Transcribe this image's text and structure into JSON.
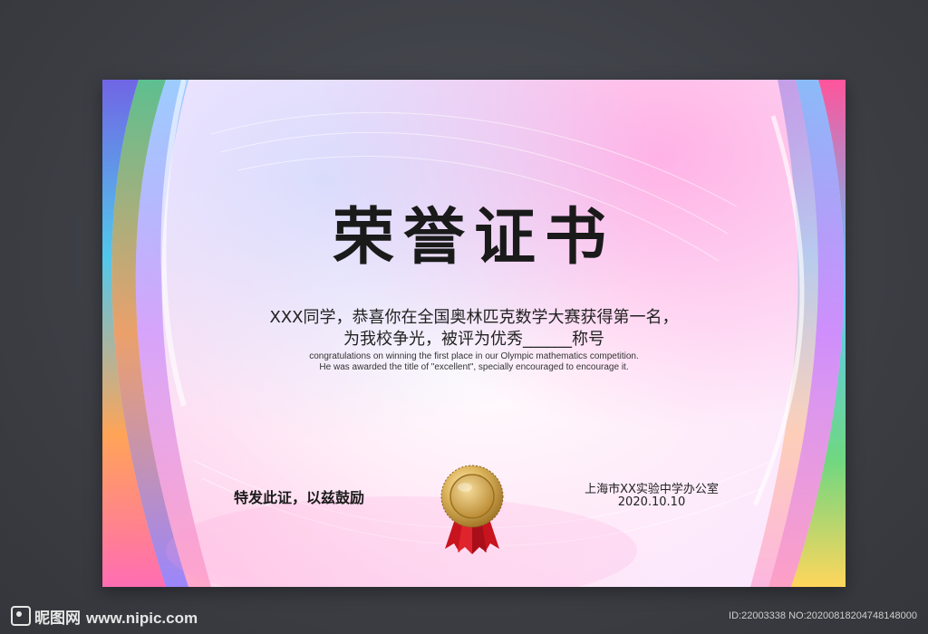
{
  "certificate": {
    "title": "荣誉证书",
    "body_cn_line1": "XXX同学，恭喜你在全国奥林匹克数学大赛获得第一名，",
    "body_cn_line2": "为我校争光，被评为优秀______称号",
    "body_en_line1": "congratulations on winning the first place in our Olympic mathematics competition.",
    "body_en_line2": "He was awarded the title of \"excellent\", specially encouraged to encourage it.",
    "closing": "特发此证，以兹鼓励",
    "issuer": "上海市XX实验中学办公室",
    "date": "2020.10.10",
    "medal_icon": "gold-medal-icon"
  },
  "footer": {
    "logo_text": "昵图网",
    "url": "www.nipic.com",
    "image_id": "ID:22003338 NO:20200818204748148000"
  },
  "colors": {
    "page_background": "#3f4147",
    "title_text": "#1a1a1a",
    "medal_gold": "#d8b25a",
    "ribbon_red": "#c8141e"
  }
}
